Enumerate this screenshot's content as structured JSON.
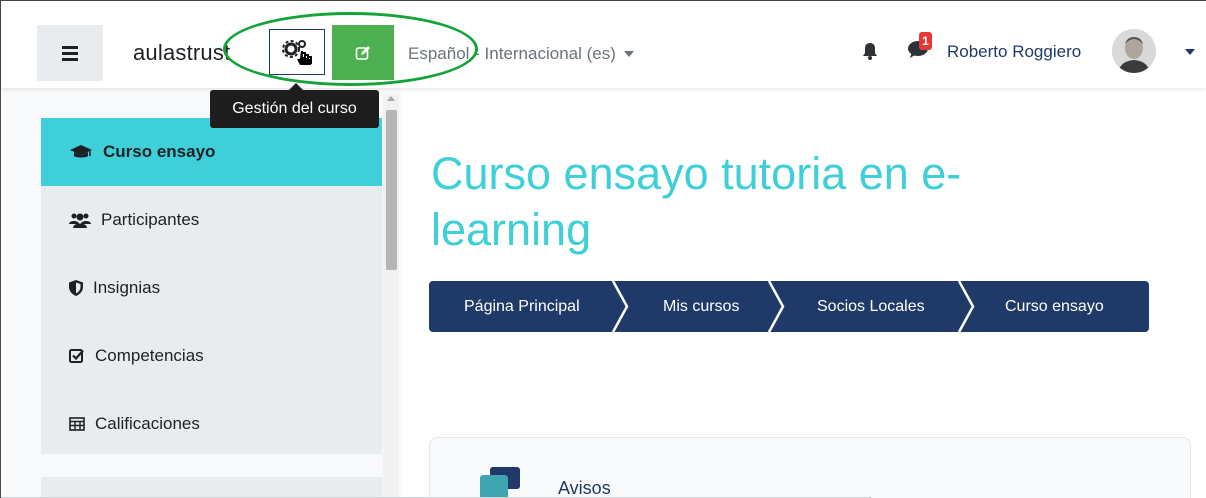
{
  "navbar": {
    "brand": "aulastrust",
    "language": "Español - Internacional (es)",
    "notification_count": "1",
    "user_name": "Roberto Roggiero"
  },
  "tooltip": {
    "text": "Gestión del curso"
  },
  "sidebar": {
    "items": [
      {
        "label": "Curso ensayo",
        "icon": "graduation-cap-icon",
        "active": true
      },
      {
        "label": "Participantes",
        "icon": "users-icon",
        "active": false
      },
      {
        "label": "Insignias",
        "icon": "shield-icon",
        "active": false
      },
      {
        "label": "Competencias",
        "icon": "check-square-icon",
        "active": false
      },
      {
        "label": "Calificaciones",
        "icon": "table-icon",
        "active": false
      }
    ]
  },
  "main": {
    "title": "Curso ensayo tutoria en e-learning",
    "breadcrumb": [
      "Página Principal",
      "Mis cursos",
      "Socios Locales",
      "Curso ensayo"
    ],
    "card_title": "Avisos"
  },
  "colors": {
    "accent": "#3fcfd9",
    "navy": "#1f3a68",
    "edit_green": "#4caf50",
    "annotation_green": "#14a336",
    "badge_red": "#e53935"
  }
}
